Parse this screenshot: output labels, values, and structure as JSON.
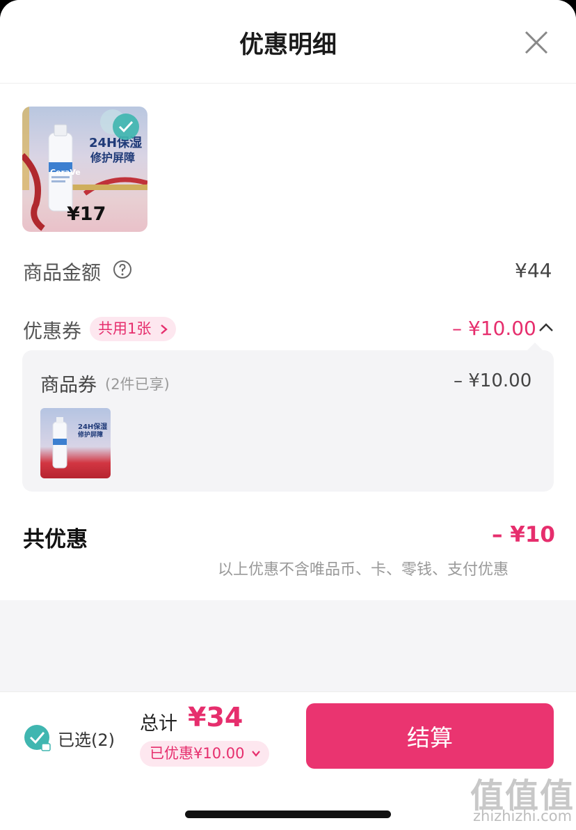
{
  "header": {
    "title": "优惠明细"
  },
  "product": {
    "thumb_price": "¥17",
    "art_line1": "24H保湿",
    "art_line2": "修护屏障",
    "art_brand": "CeraVe"
  },
  "summary": {
    "amount_label": "商品金额",
    "amount_value": "¥44"
  },
  "coupon": {
    "label": "优惠券",
    "badge": "共用1张",
    "value": "– ¥10.00",
    "detail_label": "商品券",
    "detail_note": "(2件已享)",
    "detail_value": "– ¥10.00"
  },
  "total_discount": {
    "label": "共优惠",
    "value": "– ¥10",
    "note": "以上优惠不含唯品币、卡、零钱、支付优惠"
  },
  "footer": {
    "selected": "已选(2)",
    "total_label": "总计",
    "total_value": "¥34",
    "savings": "已优惠¥10.00",
    "checkout": "结算"
  },
  "watermark": {
    "glyphs": "值值值",
    "site": "zhizhizhi.com"
  },
  "colors": {
    "accent": "#ea3470",
    "accent_text": "#e62e6d",
    "check": "#40b6b0"
  },
  "icons": [
    "close-icon",
    "check-icon",
    "help-icon",
    "chevron-right-icon",
    "chevron-up-icon",
    "chevron-down-icon",
    "lock-icon"
  ]
}
